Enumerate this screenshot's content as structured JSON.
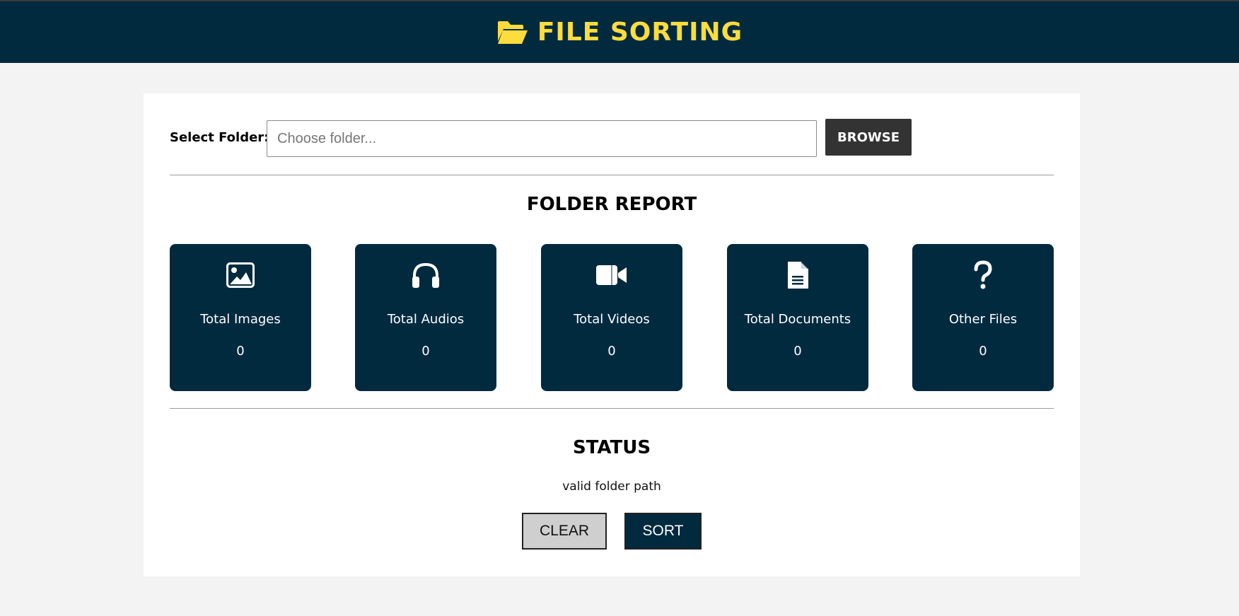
{
  "header": {
    "icon": "folder-open-icon",
    "title": "FILE SORTING",
    "colors": {
      "background": "#022a3f",
      "title": "#fddc3d"
    }
  },
  "folder_select": {
    "label": "Select Folder:",
    "input_value": "",
    "placeholder": "Choose folder...",
    "browse_label": "BROWSE"
  },
  "report": {
    "title": "FOLDER REPORT",
    "tiles": [
      {
        "icon": "image-icon",
        "label": "Total Images",
        "count": "0"
      },
      {
        "icon": "headphones-icon",
        "label": "Total Audios",
        "count": "0"
      },
      {
        "icon": "video-camera-icon",
        "label": "Total Videos",
        "count": "0"
      },
      {
        "icon": "document-icon",
        "label": "Total Documents",
        "count": "0"
      },
      {
        "icon": "question-icon",
        "label": "Other Files",
        "count": "0"
      }
    ]
  },
  "status": {
    "title": "STATUS",
    "message": "valid folder path",
    "clear_label": "CLEAR",
    "sort_label": "SORT"
  }
}
